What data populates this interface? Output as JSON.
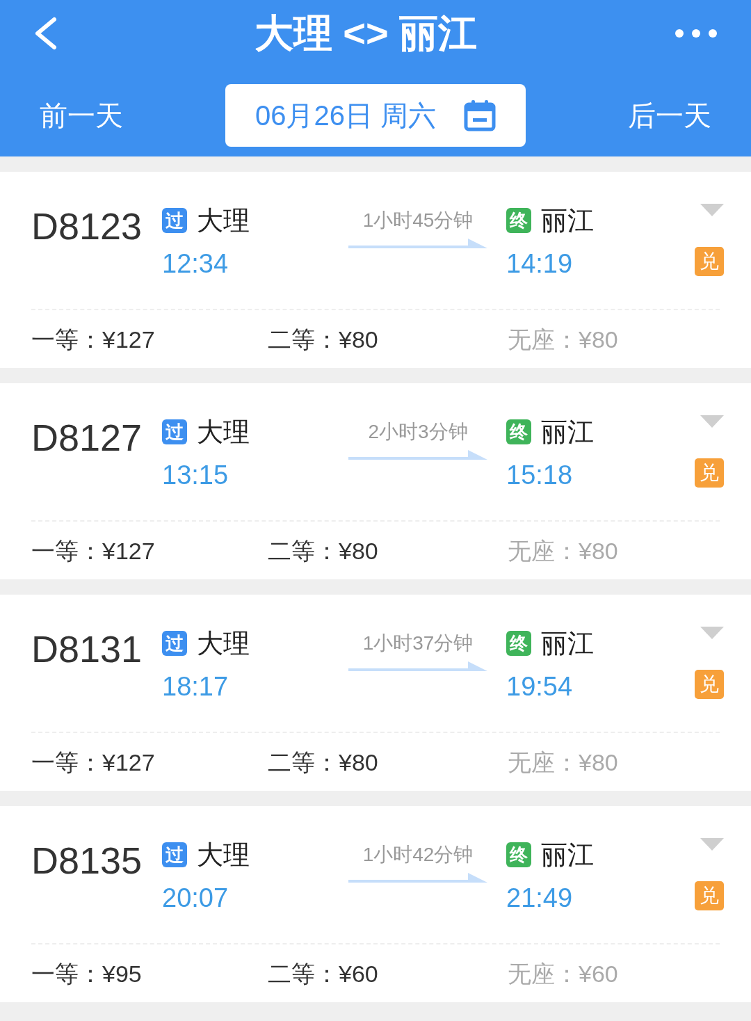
{
  "header": {
    "title": "大理 <> 丽江",
    "prev_day": "前一天",
    "date": "06月26日 周六",
    "next_day": "后一天"
  },
  "trains": [
    {
      "number": "D8123",
      "duration": "1小时45分钟",
      "badge": "兑",
      "stations": [
        {
          "tag": "过",
          "color": "#3d8ff0",
          "name": "大理",
          "time": "12:34"
        },
        {
          "tag": "终",
          "color": "#3fb45a",
          "name": "丽江",
          "time": "14:19"
        }
      ],
      "seats": [
        {
          "label": "一等：",
          "price": "¥127",
          "dimmed": false
        },
        {
          "label": "二等：",
          "price": "¥80",
          "dimmed": false
        },
        {
          "label": "无座：",
          "price": "¥80",
          "dimmed": true
        }
      ]
    },
    {
      "number": "D8127",
      "duration": "2小时3分钟",
      "badge": "兑",
      "stations": [
        {
          "tag": "过",
          "color": "#3d8ff0",
          "name": "大理",
          "time": "13:15"
        },
        {
          "tag": "终",
          "color": "#3fb45a",
          "name": "丽江",
          "time": "15:18"
        }
      ],
      "seats": [
        {
          "label": "一等：",
          "price": "¥127",
          "dimmed": false
        },
        {
          "label": "二等：",
          "price": "¥80",
          "dimmed": false
        },
        {
          "label": "无座：",
          "price": "¥80",
          "dimmed": true
        }
      ]
    },
    {
      "number": "D8131",
      "duration": "1小时37分钟",
      "badge": "兑",
      "stations": [
        {
          "tag": "过",
          "color": "#3d8ff0",
          "name": "大理",
          "time": "18:17"
        },
        {
          "tag": "终",
          "color": "#3fb45a",
          "name": "丽江",
          "time": "19:54"
        }
      ],
      "seats": [
        {
          "label": "一等：",
          "price": "¥127",
          "dimmed": false
        },
        {
          "label": "二等：",
          "price": "¥80",
          "dimmed": false
        },
        {
          "label": "无座：",
          "price": "¥80",
          "dimmed": true
        }
      ]
    },
    {
      "number": "D8135",
      "duration": "1小时42分钟",
      "badge": "兑",
      "stations": [
        {
          "tag": "过",
          "color": "#3d8ff0",
          "name": "大理",
          "time": "20:07"
        },
        {
          "tag": "终",
          "color": "#3fb45a",
          "name": "丽江",
          "time": "21:49"
        }
      ],
      "seats": [
        {
          "label": "一等：",
          "price": "¥95",
          "dimmed": false
        },
        {
          "label": "二等：",
          "price": "¥60",
          "dimmed": false
        },
        {
          "label": "无座：",
          "price": "¥60",
          "dimmed": true
        }
      ]
    }
  ]
}
